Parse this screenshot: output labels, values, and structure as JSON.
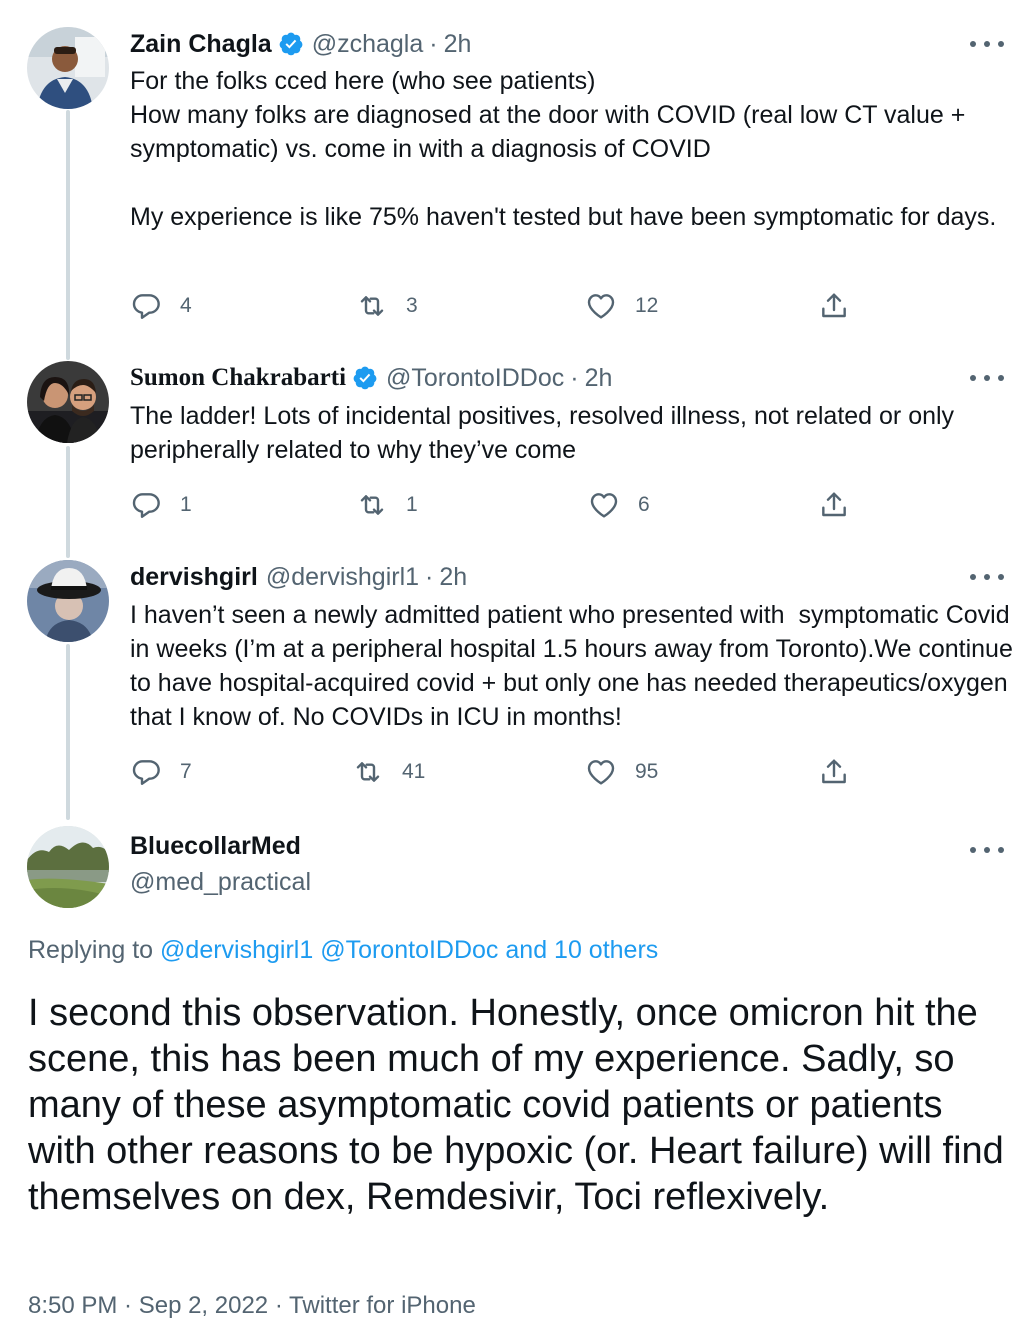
{
  "thread": [
    {
      "name": "Zain Chagla",
      "verified": true,
      "handle": "@zchagla",
      "separator": "·",
      "time": "2h",
      "text": "For the folks cced here (who see patients)\nHow many folks are diagnosed at the door with COVID (real low CT value + symptomatic) vs. come in with a diagnosis of COVID\n\nMy experience is like 75% haven't tested but have been symptomatic for days.",
      "replies": "4",
      "retweets": "3",
      "likes": "12"
    },
    {
      "name": "Sumon Chakrabarti",
      "verified": true,
      "handle": "@TorontoIDDoc",
      "separator": "·",
      "time": "2h",
      "text": "The ladder! Lots of incidental positives, resolved illness, not related or only peripherally related to why they’ve come",
      "replies": "1",
      "retweets": "1",
      "likes": "6"
    },
    {
      "name": "dervishgirl",
      "verified": false,
      "handle": "@dervishgirl1",
      "separator": "·",
      "time": "2h",
      "text": "I haven’t seen a newly admitted patient who presented with  symptomatic Covid in weeks (I’m at a peripheral hospital 1.5 hours away from Toronto).We continue to have hospital-acquired covid + but only one has needed therapeutics/oxygen that I know of. No COVIDs in ICU in months!",
      "replies": "7",
      "retweets": "41",
      "likes": "95"
    }
  ],
  "main_tweet": {
    "name": "BluecollarMed",
    "handle": "@med_practical",
    "replying_prefix": "Replying to",
    "replying_user1": "@dervishgirl1",
    "replying_user2": "@TorontoIDDoc",
    "replying_others": "and 10 others",
    "text": "I second this observation. Honestly, once omicron hit the scene, this has been much of my experience. Sadly, so many of these asymptomatic covid patients or patients with other reasons to be hypoxic (or. Heart failure) will find themselves on dex, Remdesivir, Toci reflexively.",
    "meta": "8:50 PM · Sep 2, 2022 · Twitter for iPhone"
  },
  "icons": {
    "reply": "reply-icon",
    "retweet": "retweet-icon",
    "like": "heart-icon",
    "share": "share-icon",
    "more": "more-icon",
    "verified": "verified-badge-icon"
  },
  "colors": {
    "text": "#0f1419",
    "secondary": "#536471",
    "link": "#1d9bf0",
    "verified": "#1d9bf0",
    "thread_line": "#cfd9de"
  }
}
